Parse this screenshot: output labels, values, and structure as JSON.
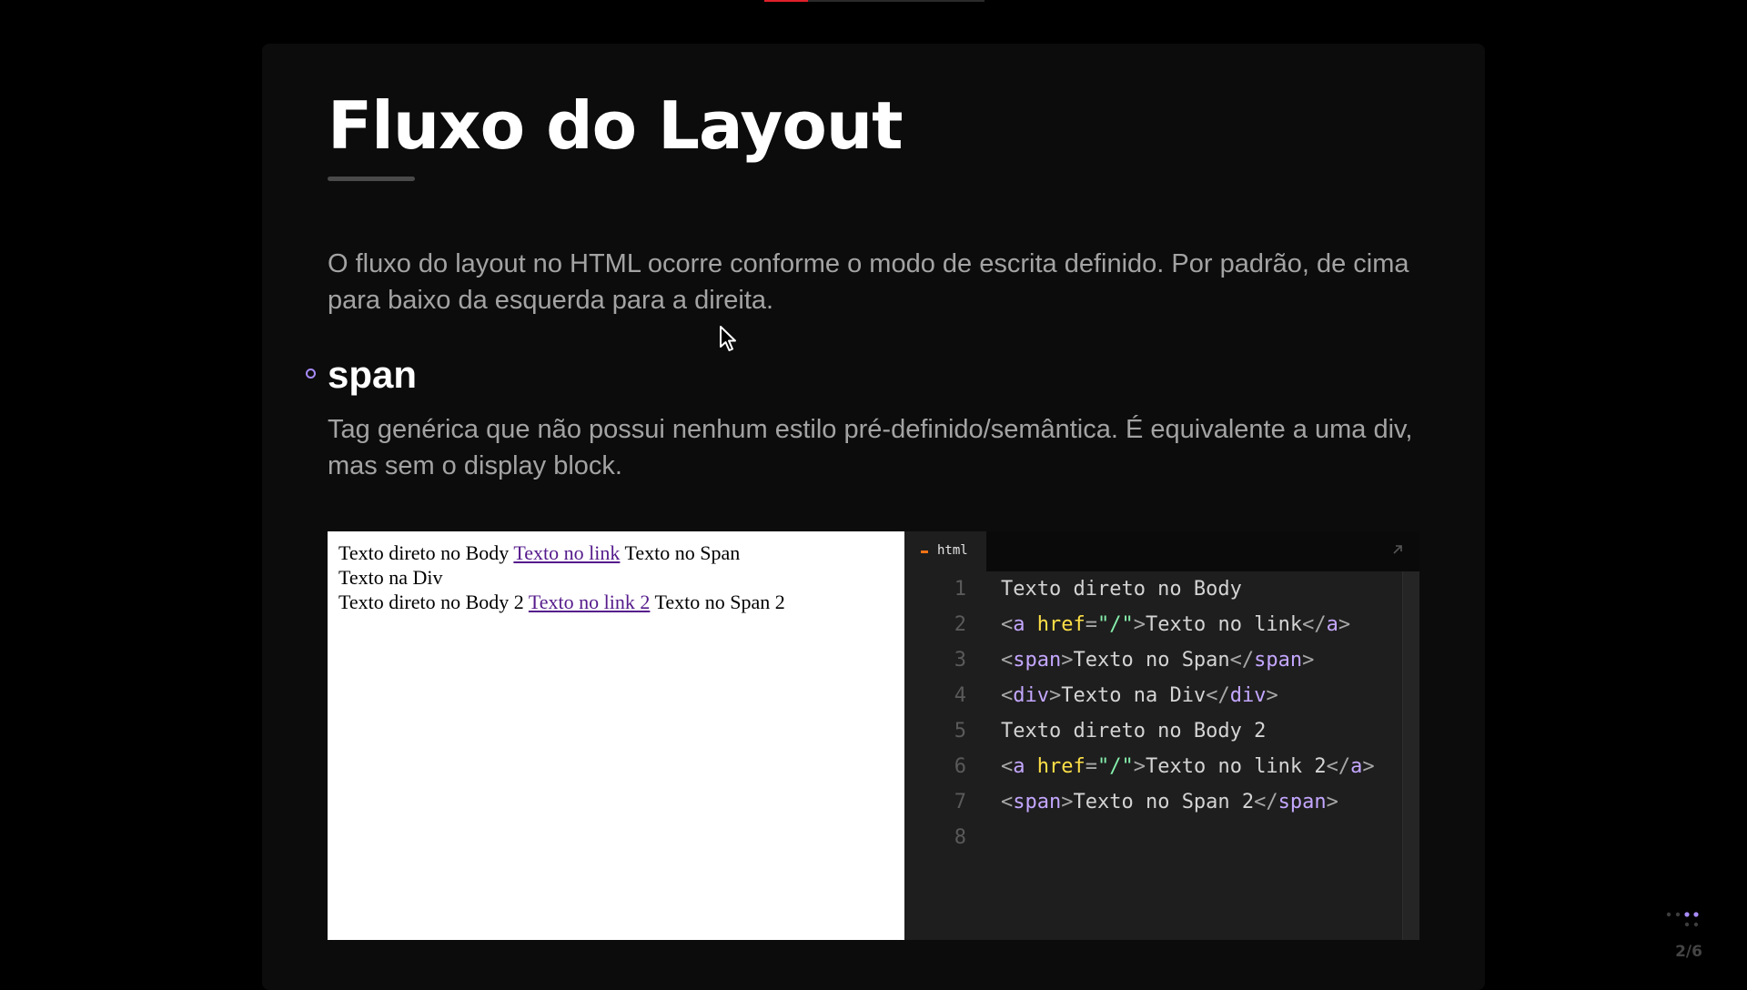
{
  "presentation": {
    "progress_fraction": 0.2,
    "accent_color": "#a78bfa",
    "progress_color": "#e0202a",
    "slide_counter": "2/6"
  },
  "slide": {
    "title": "Fluxo do Layout",
    "intro": "O fluxo do layout no HTML ocorre conforme o modo de escrita definido. Por padrão, de cima para baixo da esquerda para a direita.",
    "bullet": {
      "term": "span",
      "description": "Tag genérica que não possui nenhum estilo pré-definido/semântica. É equivalente a uma div, mas sem o display block."
    }
  },
  "preview": {
    "line1": {
      "text_before": "Texto direto no Body",
      "link": "Texto no link",
      "text_after": "Texto no Span"
    },
    "line2": {
      "text": "Texto na Div"
    },
    "line3": {
      "text_before": "Texto direto no Body 2",
      "link": "Texto no link 2",
      "text_after": "Texto no Span 2"
    }
  },
  "editor": {
    "tab_label": "html",
    "tab_mark_color": "#f97316",
    "lines": [
      {
        "num": "1",
        "tokens": [
          {
            "t": "text",
            "v": "Texto direto no Body"
          }
        ]
      },
      {
        "num": "2",
        "tokens": [
          {
            "t": "punct",
            "v": "<"
          },
          {
            "t": "tag",
            "v": "a"
          },
          {
            "t": "text",
            "v": " "
          },
          {
            "t": "attr",
            "v": "href"
          },
          {
            "t": "punct",
            "v": "="
          },
          {
            "t": "str",
            "v": "\"/\""
          },
          {
            "t": "punct",
            "v": ">"
          },
          {
            "t": "text",
            "v": "Texto no link"
          },
          {
            "t": "punct",
            "v": "</"
          },
          {
            "t": "tag",
            "v": "a"
          },
          {
            "t": "punct",
            "v": ">"
          }
        ]
      },
      {
        "num": "3",
        "tokens": [
          {
            "t": "punct",
            "v": "<"
          },
          {
            "t": "tag",
            "v": "span"
          },
          {
            "t": "punct",
            "v": ">"
          },
          {
            "t": "text",
            "v": "Texto no Span"
          },
          {
            "t": "punct",
            "v": "</"
          },
          {
            "t": "tag",
            "v": "span"
          },
          {
            "t": "punct",
            "v": ">"
          }
        ]
      },
      {
        "num": "4",
        "tokens": [
          {
            "t": "punct",
            "v": "<"
          },
          {
            "t": "tag",
            "v": "div"
          },
          {
            "t": "punct",
            "v": ">"
          },
          {
            "t": "text",
            "v": "Texto na Div"
          },
          {
            "t": "punct",
            "v": "</"
          },
          {
            "t": "tag",
            "v": "div"
          },
          {
            "t": "punct",
            "v": ">"
          }
        ]
      },
      {
        "num": "5",
        "tokens": [
          {
            "t": "text",
            "v": "Texto direto no Body 2"
          }
        ]
      },
      {
        "num": "6",
        "tokens": [
          {
            "t": "punct",
            "v": "<"
          },
          {
            "t": "tag",
            "v": "a"
          },
          {
            "t": "text",
            "v": " "
          },
          {
            "t": "attr",
            "v": "href"
          },
          {
            "t": "punct",
            "v": "="
          },
          {
            "t": "str",
            "v": "\"/\""
          },
          {
            "t": "punct",
            "v": ">"
          },
          {
            "t": "text",
            "v": "Texto no link 2"
          },
          {
            "t": "punct",
            "v": "</"
          },
          {
            "t": "tag",
            "v": "a"
          },
          {
            "t": "punct",
            "v": ">"
          }
        ]
      },
      {
        "num": "7",
        "tokens": [
          {
            "t": "punct",
            "v": "<"
          },
          {
            "t": "tag",
            "v": "span"
          },
          {
            "t": "punct",
            "v": ">"
          },
          {
            "t": "text",
            "v": "Texto no Span 2"
          },
          {
            "t": "punct",
            "v": "</"
          },
          {
            "t": "tag",
            "v": "span"
          },
          {
            "t": "punct",
            "v": ">"
          }
        ]
      },
      {
        "num": "8",
        "tokens": []
      }
    ]
  },
  "icons": {
    "bullet": "circle-bullet-icon",
    "expand": "expand-arrow-icon",
    "nav": "slide-nav-dots-icon",
    "cursor": "mouse-pointer-icon"
  }
}
